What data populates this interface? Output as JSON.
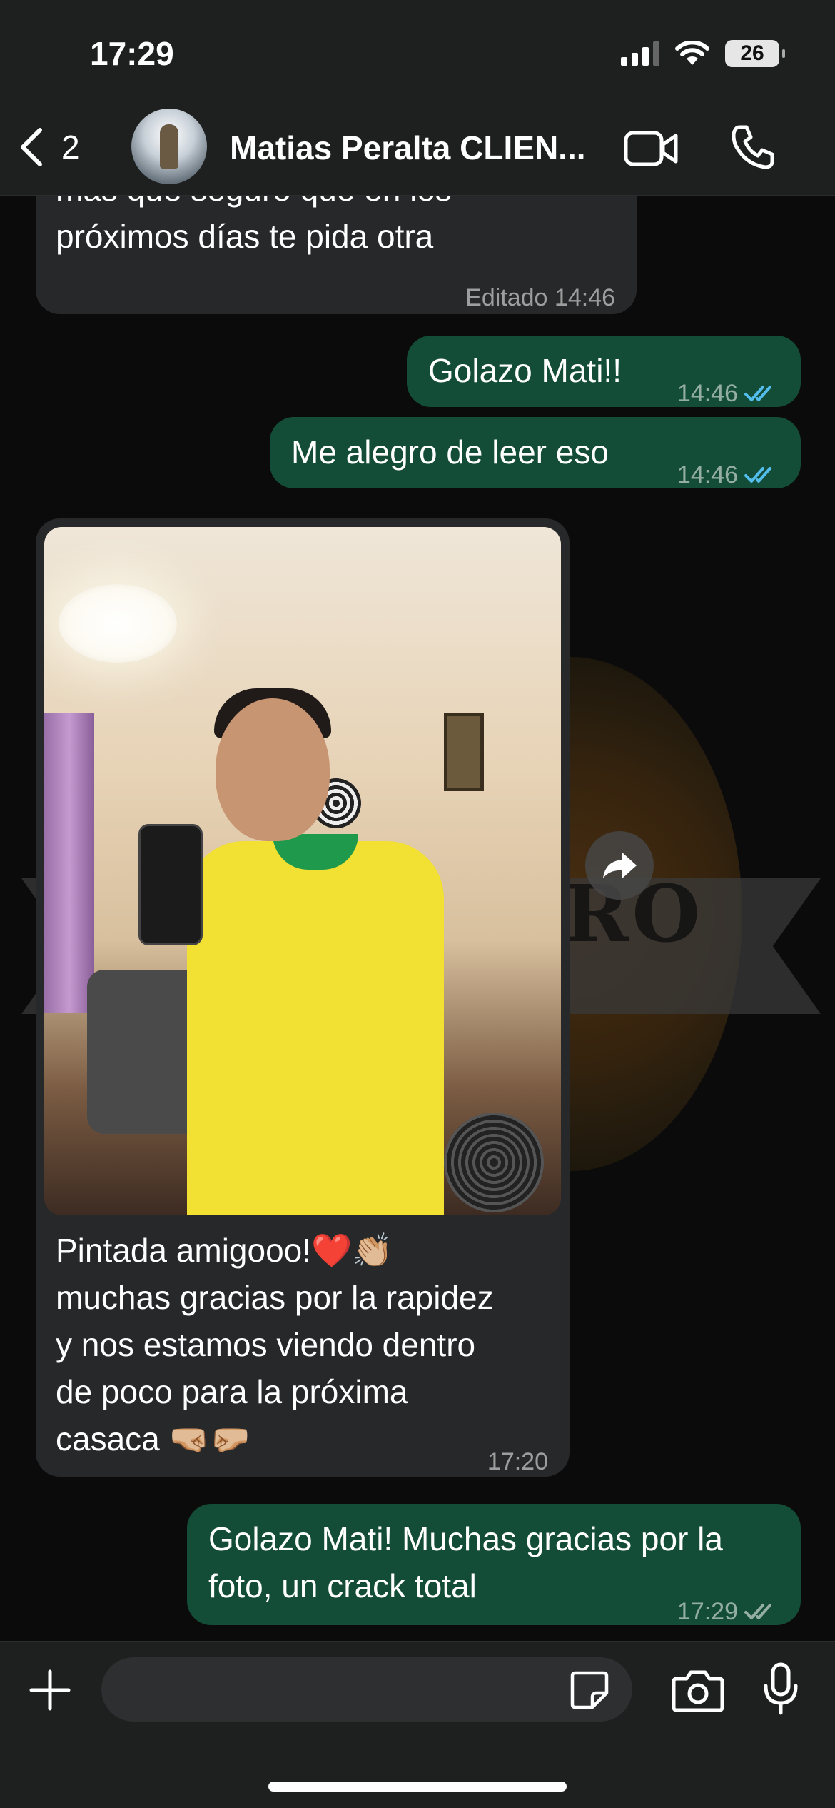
{
  "status_bar": {
    "time": "17:29",
    "battery": "26"
  },
  "header": {
    "back_count": "2",
    "contact_name": "Matias Peralta CLIEN..."
  },
  "messages": [
    {
      "direction": "in",
      "text_cut": "más que seguro que en los",
      "text": "próximos días te pida otra",
      "time": "Editado 14:46"
    },
    {
      "direction": "out",
      "text": "Golazo Mati!!",
      "time": "14:46",
      "status": "read"
    },
    {
      "direction": "out",
      "text": "Me alegro de leer eso",
      "time": "14:46",
      "status": "read"
    },
    {
      "direction": "in",
      "type": "image",
      "caption_lines": [
        "Pintada amigooo!❤️👏🏼",
        "muchas gracias por la rapidez",
        "y nos estamos viendo dentro",
        "de poco para la próxima",
        "casaca 🤜🏼🤛🏼"
      ],
      "time": "17:20"
    },
    {
      "direction": "out",
      "text_lines": [
        "Golazo Mati! Muchas gracias por la",
        "foto, un crack total"
      ],
      "time": "17:29",
      "status": "delivered"
    }
  ],
  "watermark": {
    "text": "RO"
  },
  "colors": {
    "incoming": "#262829",
    "outgoing": "#144d37",
    "read_tick": "#53bdeb",
    "header": "#1e1f1f"
  },
  "icons": [
    "chevron-left-icon",
    "video-call-icon",
    "phone-icon",
    "plus-icon",
    "sticker-icon",
    "camera-icon",
    "microphone-icon",
    "forward-icon"
  ]
}
